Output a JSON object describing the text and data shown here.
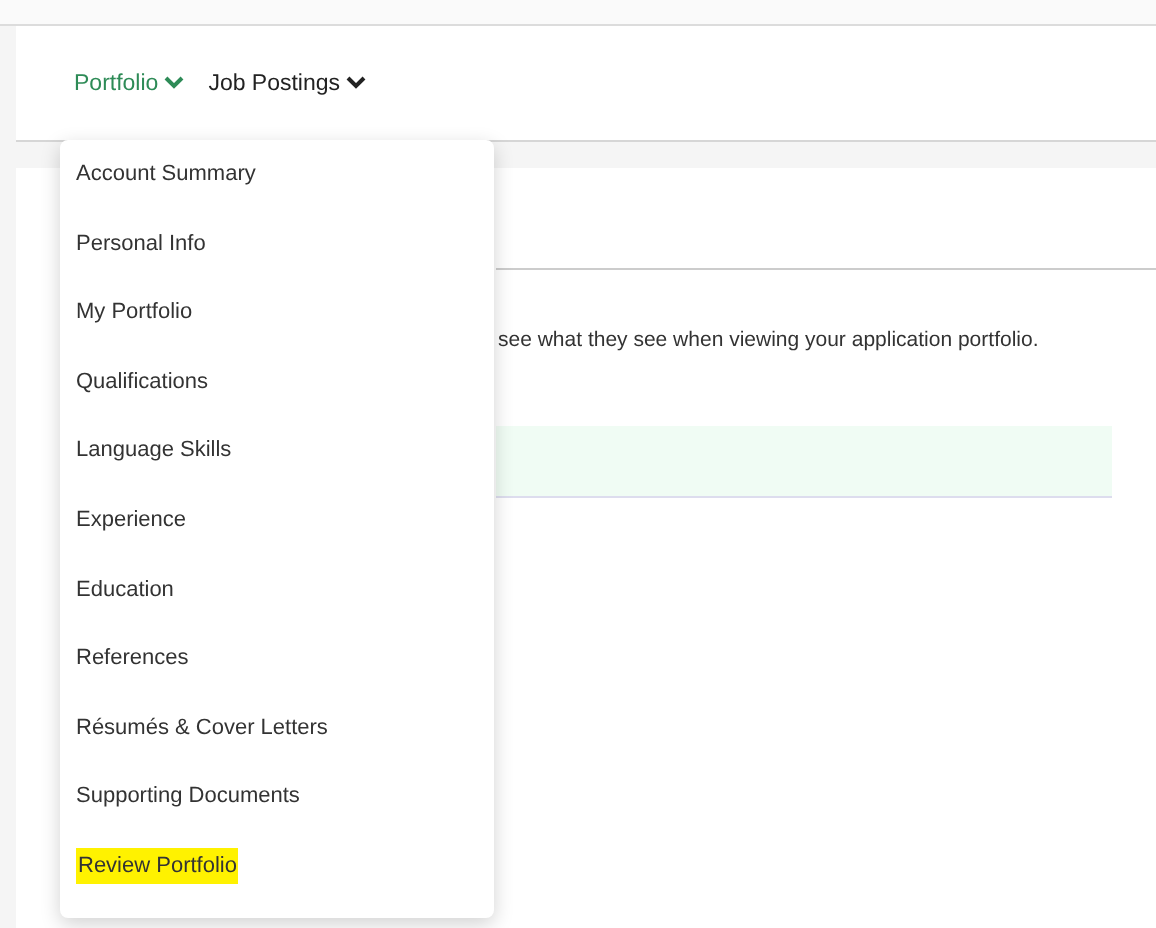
{
  "nav": [
    {
      "label": "Portfolio",
      "selected": true
    },
    {
      "label": "Job Postings",
      "selected": false
    }
  ],
  "menu": [
    {
      "label": "Account Summary",
      "highlighted": false
    },
    {
      "label": "Personal Info",
      "highlighted": false
    },
    {
      "label": "My Portfolio",
      "highlighted": false
    },
    {
      "label": "Qualifications",
      "highlighted": false
    },
    {
      "label": "Language Skills",
      "highlighted": false
    },
    {
      "label": "Experience",
      "highlighted": false
    },
    {
      "label": "Education",
      "highlighted": false
    },
    {
      "label": "References",
      "highlighted": false
    },
    {
      "label": "Résumés & Cover Letters",
      "highlighted": false
    },
    {
      "label": "Supporting Documents",
      "highlighted": false
    },
    {
      "label": "Review Portfolio",
      "highlighted": true
    }
  ],
  "content": {
    "text": "see what they see when viewing your application portfolio."
  }
}
